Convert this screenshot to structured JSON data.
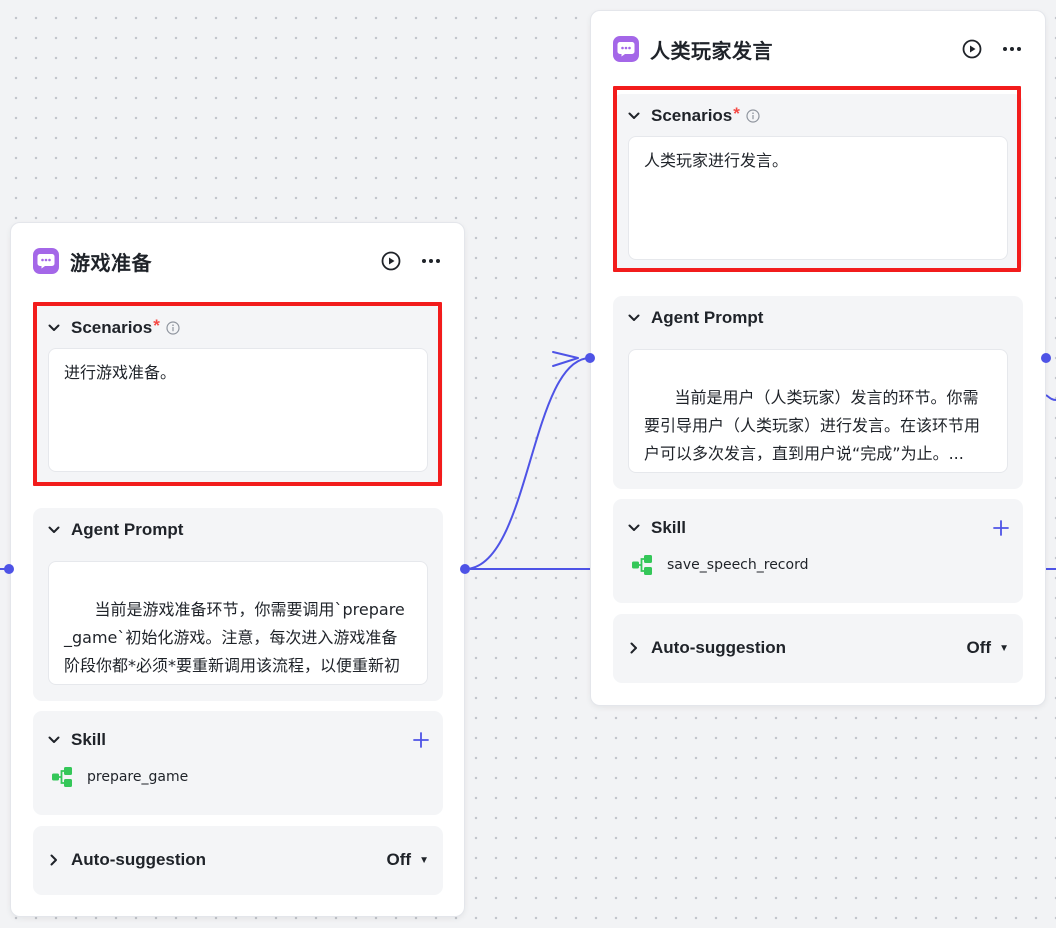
{
  "colors": {
    "accent": "#4e53e6",
    "bot_icon": "#a467e8",
    "skill_icon": "#34c759",
    "highlight": "#f21c1c",
    "required": "#f54a45"
  },
  "nodes": [
    {
      "title": "游戏准备",
      "icon": "bot-icon",
      "scenarios": {
        "label": "Scenarios",
        "required_mark": "*",
        "text": "进行游戏准备。"
      },
      "agent_prompt": {
        "label": "Agent Prompt",
        "text": "当前是游戏准备环节，你需要调用`prepare_game`初始化游戏。注意，每次进入游戏准备阶段你都*必须*要重新调用该流程，以便重新初始化游戏。..."
      },
      "skill": {
        "label": "Skill",
        "items": [
          "prepare_game"
        ]
      },
      "auto_suggestion": {
        "label": "Auto-suggestion",
        "value": "Off"
      }
    },
    {
      "title": "人类玩家发言",
      "icon": "bot-icon",
      "scenarios": {
        "label": "Scenarios",
        "required_mark": "*",
        "text": "人类玩家进行发言。"
      },
      "agent_prompt": {
        "label": "Agent Prompt",
        "text": "当前是用户（人类玩家）发言的环节。你需要引导用户（人类玩家）进行发言。在该环节用户可以多次发言，直到用户说“完成”为止。..."
      },
      "skill": {
        "label": "Skill",
        "items": [
          "save_speech_record"
        ]
      },
      "auto_suggestion": {
        "label": "Auto-suggestion",
        "value": "Off"
      }
    }
  ]
}
